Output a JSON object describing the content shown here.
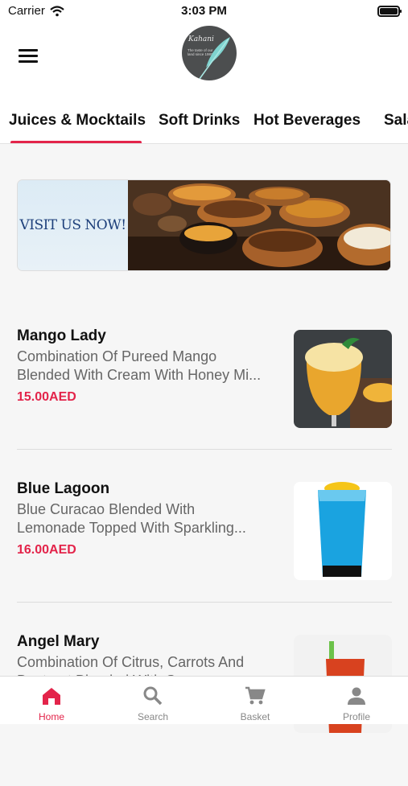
{
  "status_bar": {
    "carrier": "Carrier",
    "time": "3:03 PM"
  },
  "header": {
    "logo_text": "Kahani",
    "logo_sub": "The taste of our land since 1980"
  },
  "tabs": [
    {
      "label": "Juices & Mocktails",
      "active": true
    },
    {
      "label": "Soft Drinks",
      "active": false
    },
    {
      "label": "Hot Beverages",
      "active": false
    },
    {
      "label": "Sala",
      "active": false
    }
  ],
  "banner": {
    "text": "VISIT US NOW!"
  },
  "items": [
    {
      "name": "Mango Lady",
      "desc_line1": "Combination Of Pureed Mango",
      "desc_line2": "Blended With Cream With Honey Mi...",
      "price": "15.00AED"
    },
    {
      "name": "Blue Lagoon",
      "desc_line1": "Blue Curacao Blended With",
      "desc_line2": "Lemonade Topped With Sparkling...",
      "price": "16.00AED"
    },
    {
      "name": "Angel Mary",
      "desc_line1": "Combination Of Citrus, Carrots And",
      "desc_line2": "Beetroot Blended With S...",
      "price": ""
    }
  ],
  "bottom_nav": [
    {
      "label": "Home",
      "icon": "home-icon",
      "active": true
    },
    {
      "label": "Search",
      "icon": "search-icon",
      "active": false
    },
    {
      "label": "Basket",
      "icon": "cart-icon",
      "active": false
    },
    {
      "label": "Profile",
      "icon": "profile-icon",
      "active": false
    }
  ],
  "colors": {
    "accent": "#e3244a",
    "inactive": "#888888"
  }
}
